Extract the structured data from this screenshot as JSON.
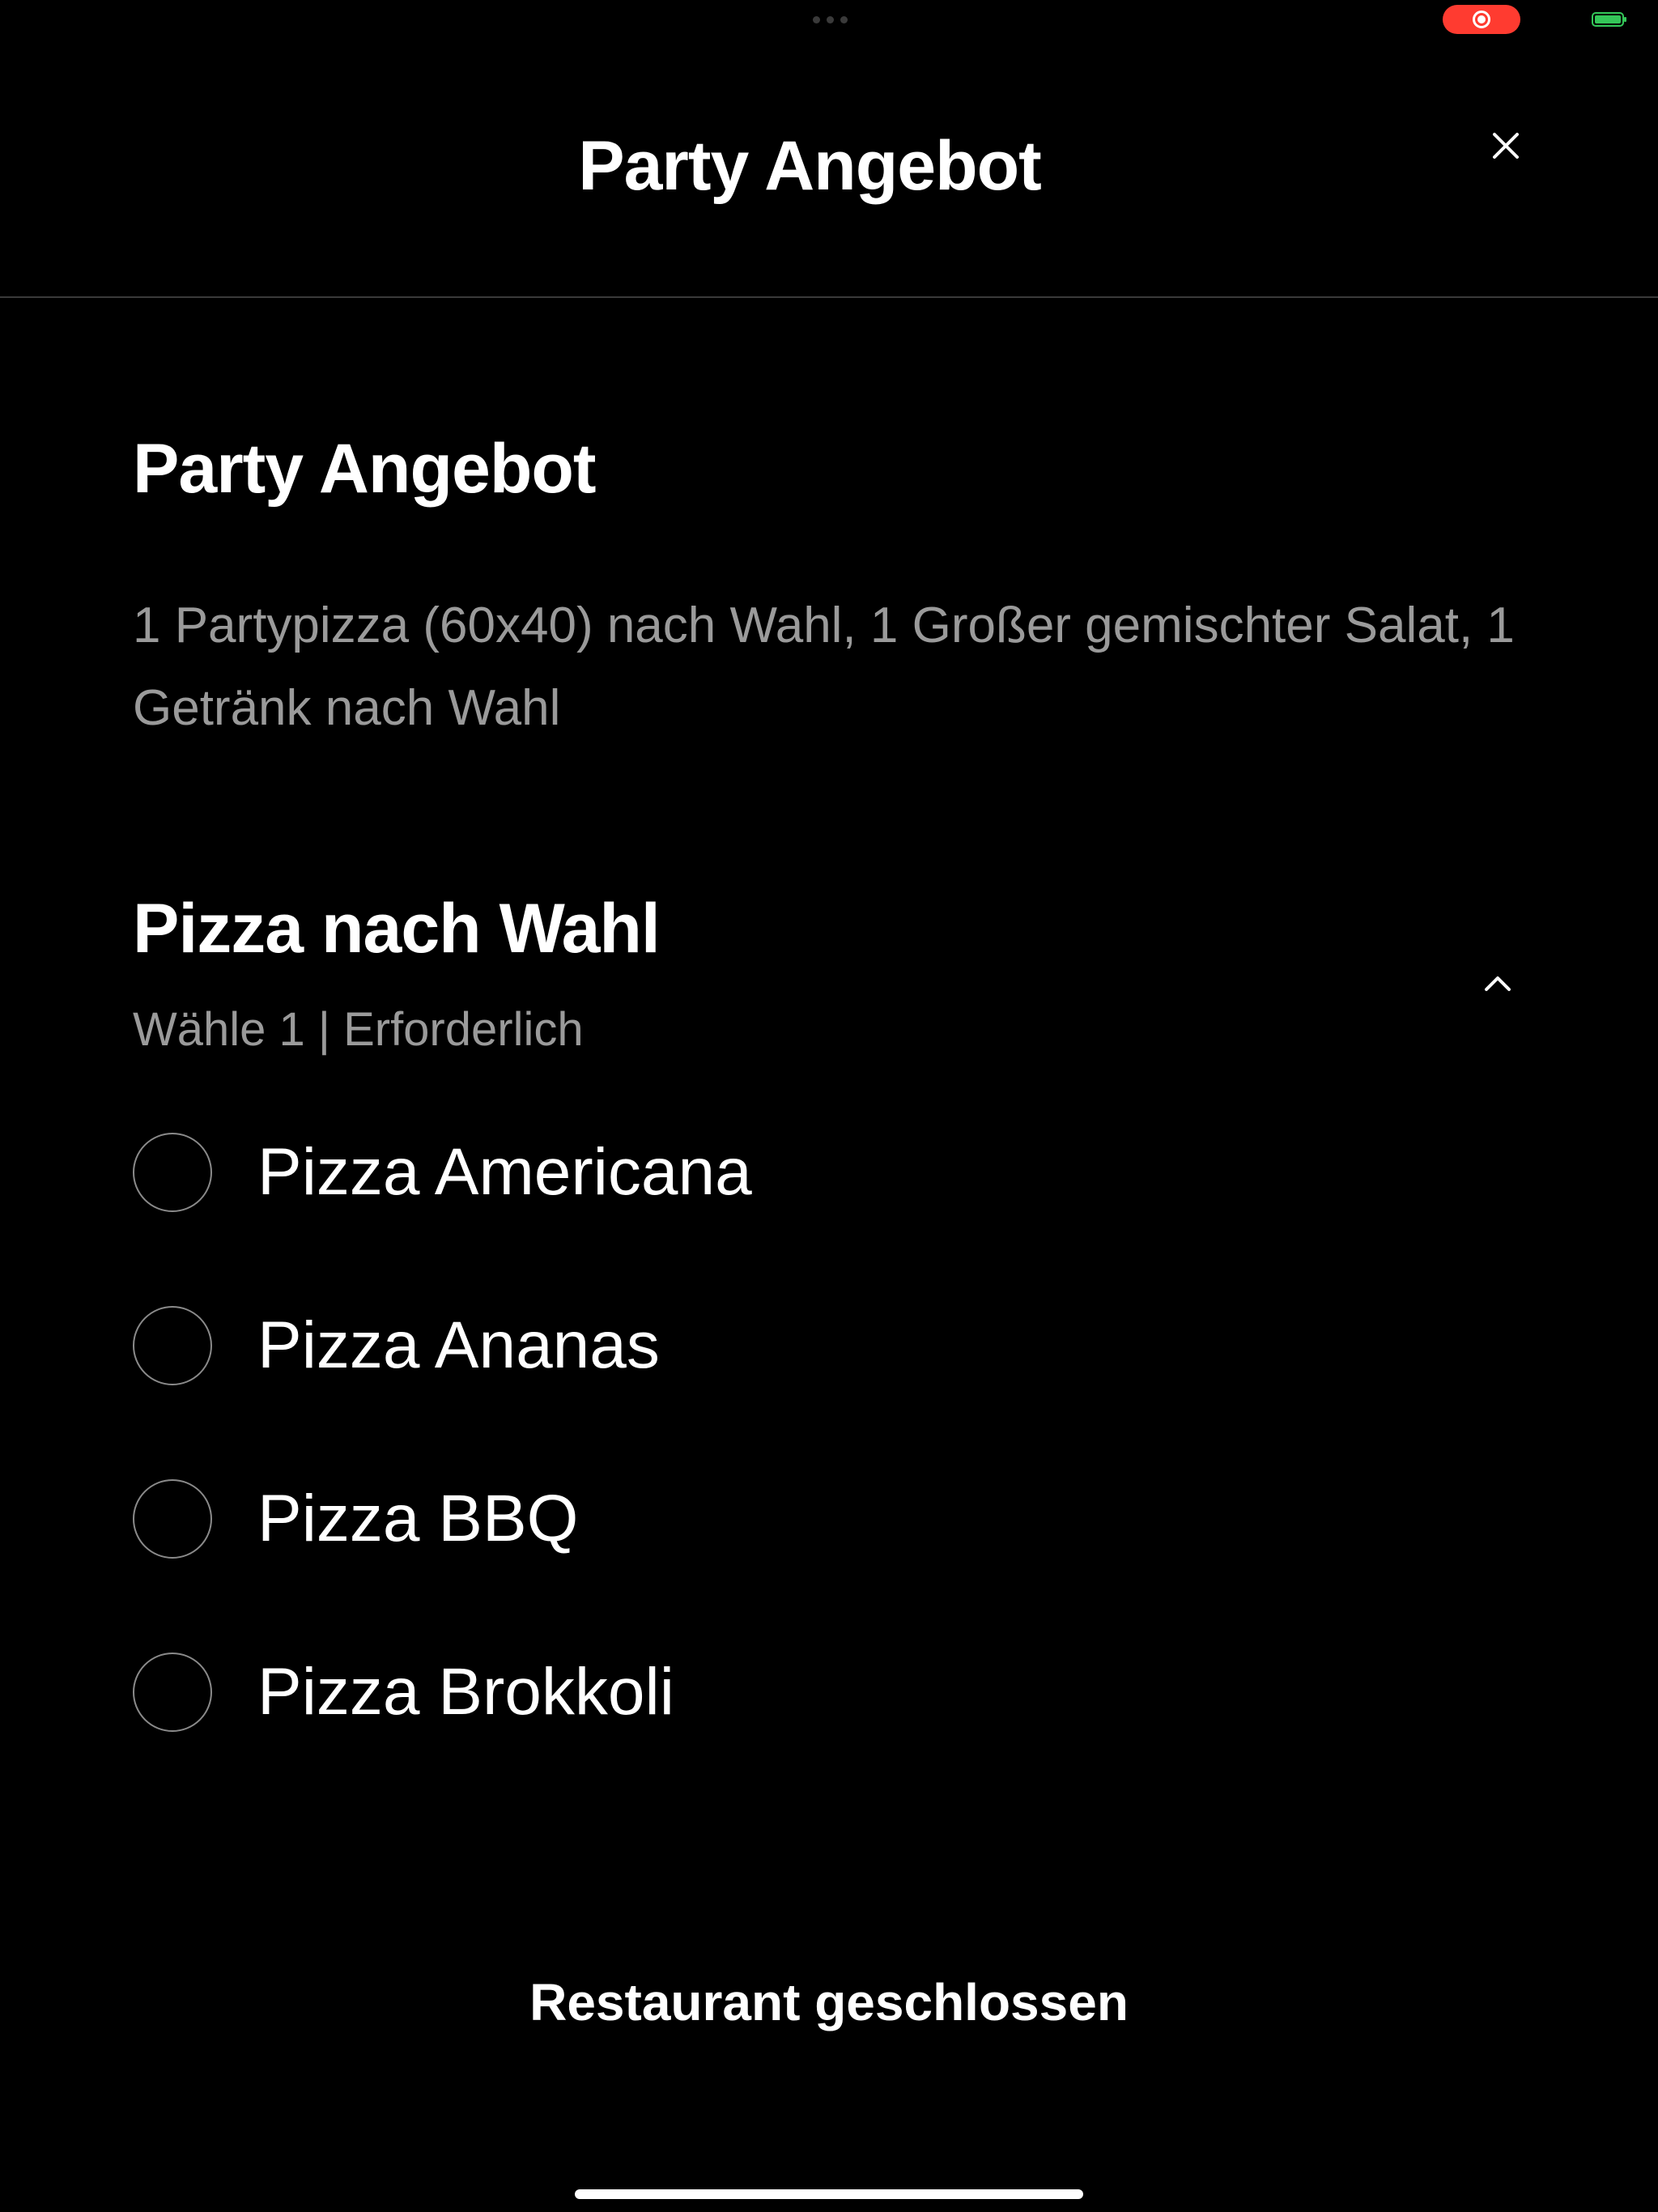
{
  "status_bar": {
    "record_indicator_color": "#ff3b30",
    "battery_color": "#34c759"
  },
  "header": {
    "title": "Party Angebot",
    "close_icon": "close-icon"
  },
  "item": {
    "title": "Party Angebot",
    "description": "1 Partypizza (60x40) nach Wahl, 1 Großer gemischter Salat, 1 Getränk nach Wahl"
  },
  "section": {
    "title": "Pizza nach Wahl",
    "meta": "Wähle 1  |  Erforderlich",
    "collapse_icon": "chevron-up-icon",
    "options": [
      {
        "label": "Pizza Americana",
        "selected": false
      },
      {
        "label": "Pizza Ananas",
        "selected": false
      },
      {
        "label": "Pizza BBQ",
        "selected": false
      },
      {
        "label": "Pizza Brokkoli",
        "selected": false
      }
    ]
  },
  "footer": {
    "status": "Restaurant geschlossen"
  }
}
